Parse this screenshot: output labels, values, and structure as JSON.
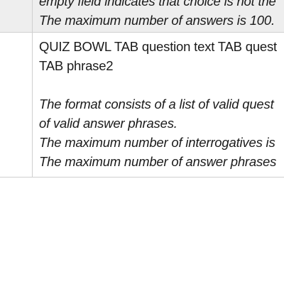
{
  "rows": [
    {
      "label": "",
      "lines": [
        {
          "text": "empty field indicates that choice is not the",
          "italic": true
        },
        {
          "text": "The maximum number of answers is 100.",
          "italic": true
        }
      ]
    },
    {
      "label": "",
      "lines": [
        {
          "text": "QUIZ BOWL TAB question text TAB quest",
          "italic": false
        },
        {
          "text": "TAB phrase2",
          "italic": false
        },
        {
          "text": "",
          "italic": false
        },
        {
          "text": "The format consists of a list of valid quest",
          "italic": true
        },
        {
          "text": "of valid answer phrases.",
          "italic": true
        },
        {
          "text": "The maximum number of interrogatives is",
          "italic": true
        },
        {
          "text": "The maximum number of answer phrases",
          "italic": true
        }
      ]
    }
  ]
}
